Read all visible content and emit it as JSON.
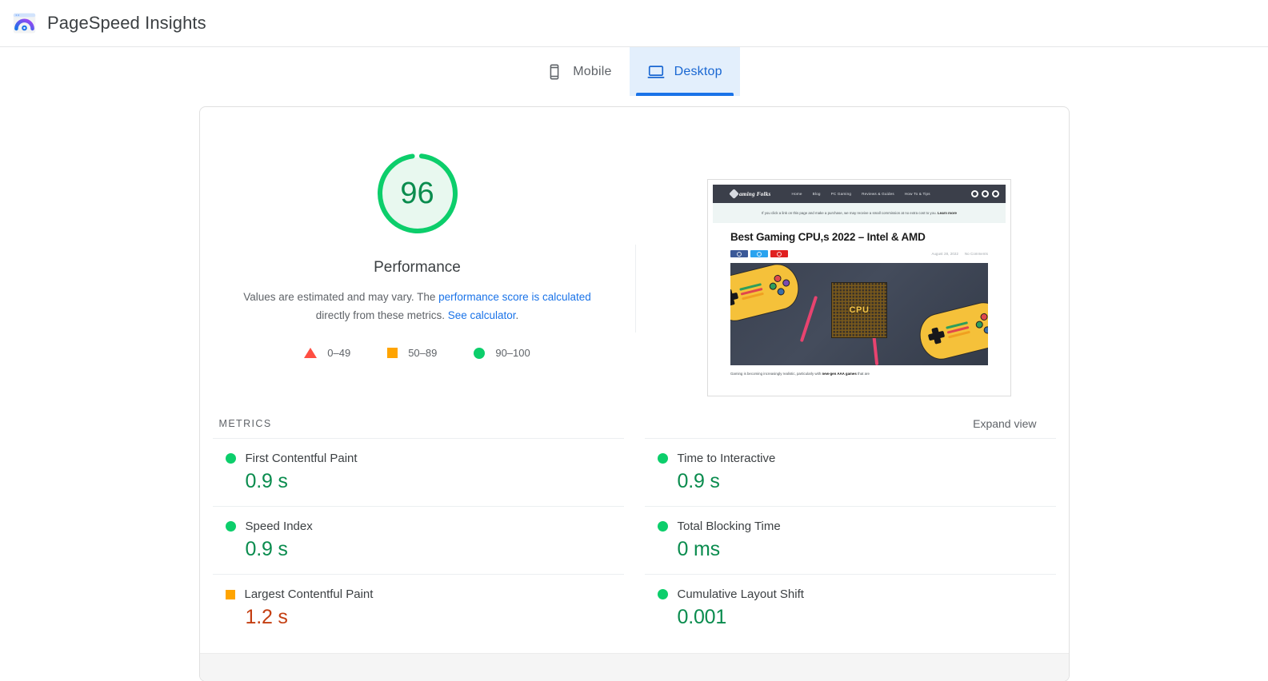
{
  "header": {
    "title": "PageSpeed Insights",
    "logo_icon": "pagespeed-logo-icon"
  },
  "tabs": [
    {
      "label": "Mobile",
      "icon": "mobile-phone-icon",
      "active": false
    },
    {
      "label": "Desktop",
      "icon": "desktop-monitor-icon",
      "active": true
    }
  ],
  "summary": {
    "score": "96",
    "category_label": "Performance",
    "description_prefix": "Values are estimated and may vary. The ",
    "description_link1": "performance score is calculated",
    "description_middle": " directly from these metrics. ",
    "description_link2": "See calculator",
    "description_suffix": ".",
    "gauge_color": "#0cce6b",
    "gauge_fill": "#e8f8ef",
    "score_color": "#0a8c4e"
  },
  "legend": [
    {
      "shape": "triangle",
      "range": "0–49",
      "color": "#ff4e42"
    },
    {
      "shape": "square",
      "range": "50–89",
      "color": "#ffa400"
    },
    {
      "shape": "circle",
      "range": "90–100",
      "color": "#0cce6b"
    }
  ],
  "screenshot_preview": {
    "site_logo": "aming Folks",
    "nav_links": [
      "Home",
      "Blog",
      "PC Gaming",
      "Reviews & Guides",
      "How To & Tips"
    ],
    "social_icons": [
      "facebook-icon",
      "twitter-icon",
      "youtube-icon"
    ],
    "affiliate_notice": "If you click a link on this page and make a purchase, we may receive a small commission at no extra cost to you.",
    "affiliate_notice_link": "Learn more",
    "headline": "Best Gaming CPU,s 2022 – Intel & AMD",
    "post_date": "August 28, 2022",
    "post_comments": "No Comments",
    "hero_chip_label": "CPU",
    "body_excerpt": "Gaming is becoming increasingly realistic, particularly with ",
    "body_excerpt_bold": "new-gen AAA games",
    "body_excerpt_tail": " that are"
  },
  "metrics": {
    "section_title": "METRICS",
    "expand_label": "Expand view",
    "left_column": [
      {
        "name": "First Contentful Paint",
        "value": "0.9 s",
        "status": "good",
        "shape": "circle"
      },
      {
        "name": "Speed Index",
        "value": "0.9 s",
        "status": "good",
        "shape": "circle"
      },
      {
        "name": "Largest Contentful Paint",
        "value": "1.2 s",
        "status": "average",
        "shape": "square"
      }
    ],
    "right_column": [
      {
        "name": "Time to Interactive",
        "value": "0.9 s",
        "status": "good",
        "shape": "circle"
      },
      {
        "name": "Total Blocking Time",
        "value": "0 ms",
        "status": "good",
        "shape": "circle"
      },
      {
        "name": "Cumulative Layout Shift",
        "value": "0.001",
        "status": "good",
        "shape": "circle"
      }
    ]
  }
}
